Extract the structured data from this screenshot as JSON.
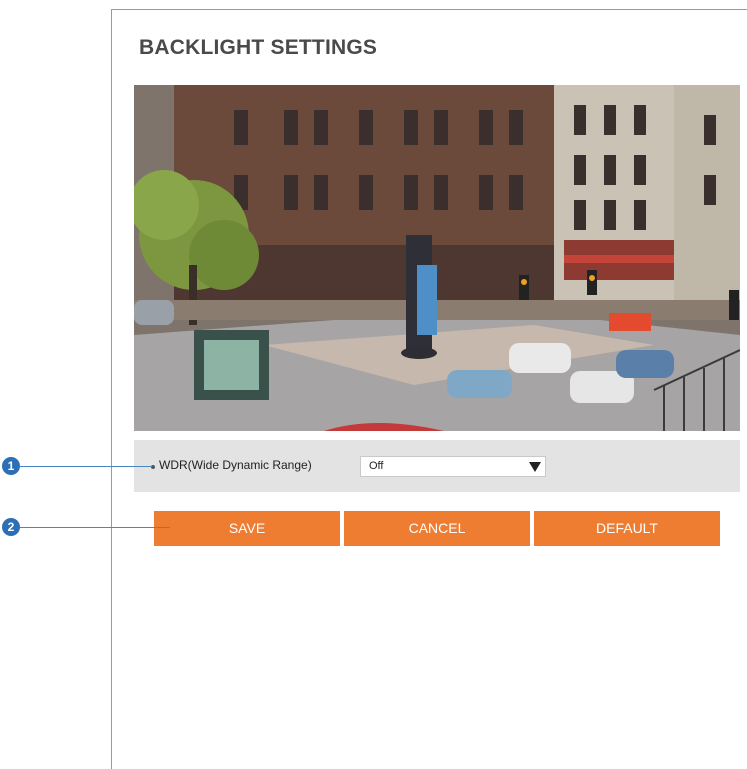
{
  "title": "BACKLIGHT SETTINGS",
  "wdr": {
    "label": "WDR(Wide Dynamic Range)",
    "value": "Off"
  },
  "buttons": {
    "save": "SAVE",
    "cancel": "CANCEL",
    "default": "DEFAULT"
  },
  "callouts": [
    "1",
    "2"
  ],
  "colors": {
    "button": "#ee7d31",
    "callout": "#2d6fb5",
    "settings_bg": "#e3e3e3"
  }
}
